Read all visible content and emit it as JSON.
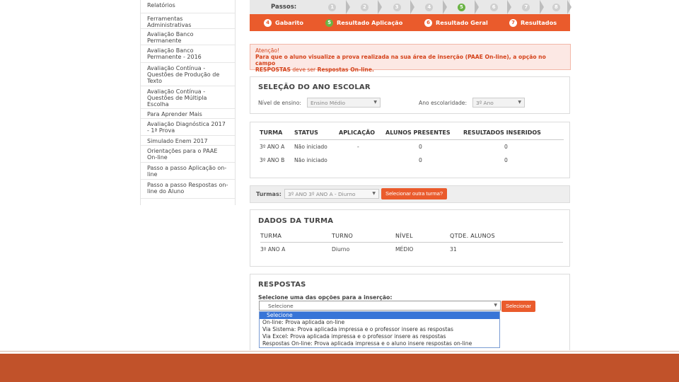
{
  "sidebar": {
    "items": [
      {
        "label": "Relatórios"
      },
      {
        "label": "Ferramentas Administrativas"
      },
      {
        "label": "Avaliação Banco Permanente"
      },
      {
        "label": "Avaliação Banco Permanente - 2016"
      },
      {
        "label": "Avaliação Contínua - Questões de Produção de Texto"
      },
      {
        "label": "Avaliação Contínua - Questões de Múltipla Escolha"
      },
      {
        "label": "Para Aprender Mais"
      },
      {
        "label": "Avaliação Diagnóstica 2017 - 1ª Prova"
      },
      {
        "label": "Simulado Enem 2017"
      },
      {
        "label": "Orientações para o PAAE On-line"
      },
      {
        "label": "Passo a passo Aplicação on-line"
      },
      {
        "label": "Passo a passo Respostas on-line do Aluno"
      }
    ]
  },
  "steps": {
    "label": "Passos:",
    "numbers": [
      "1",
      "2",
      "3",
      "4",
      "5",
      "6",
      "7",
      "8"
    ],
    "active": "5",
    "tabs": [
      {
        "num": "4",
        "label": "Gabarito"
      },
      {
        "num": "5",
        "label": "Resultado Aplicação"
      },
      {
        "num": "6",
        "label": "Resultado Geral"
      },
      {
        "num": "7",
        "label": "Resultados"
      }
    ]
  },
  "alert": {
    "title": "Atenção!",
    "line1": "Para que o aluno visualize a prova realizada na sua área de inserção (PAAE On-line), a opção no campo",
    "line2_bold": "RESPOSTAS",
    "line2_mid": " deve ser ",
    "line2_end": "Respostas On-line."
  },
  "ano_escolar": {
    "title": "SELEÇÃO DO ANO ESCOLAR",
    "nivel_label": "Nível de ensino:",
    "nivel_value": "Ensino Médio",
    "ano_label": "Ano escolaridade:",
    "ano_value": "3º Ano"
  },
  "turmas_table": {
    "headers": [
      "TURMA",
      "STATUS",
      "APLICAÇÃO",
      "ALUNOS PRESENTES",
      "RESULTADOS INSERIDOS"
    ],
    "rows": [
      [
        "3º ANO A",
        "Não iniciado",
        "-",
        "0",
        "0"
      ],
      [
        "3º ANO B",
        "Não iniciado",
        "",
        "0",
        "0"
      ]
    ]
  },
  "turmas_bar": {
    "label": "Turmas:",
    "select_value": "3º ANO 3º ANO A - Diurno",
    "button": "Selecionar outra turma?"
  },
  "dados_turma": {
    "title": "DADOS DA TURMA",
    "headers": [
      "TURMA",
      "TURNO",
      "NÍVEL",
      "QTDE. ALUNOS"
    ],
    "row": [
      "3º ANO A",
      "Diurno",
      "MÉDIO",
      "31"
    ]
  },
  "respostas": {
    "title": "RESPOSTAS",
    "prompt": "Selecione uma das opções para a inserção:",
    "select_value": "Selecione",
    "button": "Selecionar",
    "options": [
      "Selecione",
      "On-line: Prova aplicada on-line",
      "Via Sistema: Prova aplicada impressa e o professor insere as respostas",
      "Via Excel: Prova aplicada impressa e o professor insere as respostas",
      "Respostas On-line: Prova aplicada impressa e o aluno insere respostas on-line"
    ]
  },
  "colors": {
    "accent": "#ea5b2c",
    "active_step": "#6ab344",
    "footer": "#c1522a"
  }
}
